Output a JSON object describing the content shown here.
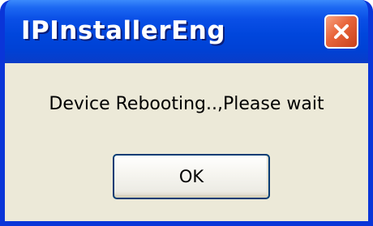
{
  "window": {
    "title": "IPInstallerEng",
    "close_icon": "close-icon"
  },
  "dialog": {
    "message": "Device Rebooting..,Please wait",
    "ok_label": "OK"
  },
  "colors": {
    "titlebar": "#0046dc",
    "client_background": "#ece9d8",
    "close_button": "#e8643a"
  }
}
